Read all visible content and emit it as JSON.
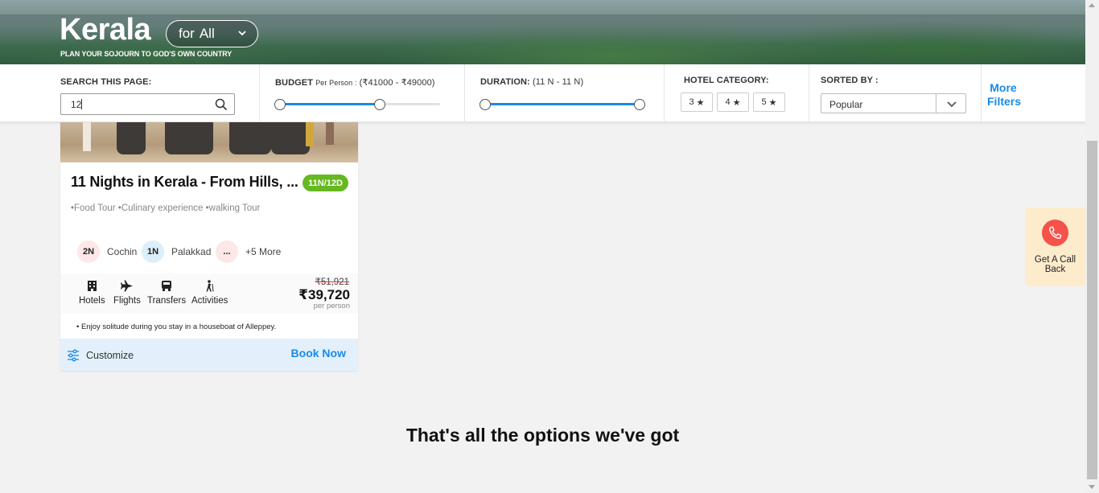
{
  "header": {
    "title": "Kerala",
    "subtitle": "PLAN YOUR SOJOURN TO GOD'S OWN COUNTRY",
    "for_prefix": "for",
    "for_value": "All"
  },
  "filters": {
    "search": {
      "label": "SEARCH THIS PAGE:",
      "value": "12"
    },
    "budget": {
      "label": "BUDGET",
      "sublabel": "Per Person :",
      "range": "(₹41000 - ₹49000)",
      "min_value": 41000,
      "max_value": 49000
    },
    "duration": {
      "label": "DURATION:",
      "range": "(11 N - 11 N)",
      "min_nights": 11,
      "max_nights": 11
    },
    "hotel_category": {
      "label": "HOTEL CATEGORY:",
      "options": [
        "3",
        "4",
        "5"
      ],
      "star_glyph": "★"
    },
    "sort": {
      "label": "SORTED BY :",
      "value": "Popular"
    },
    "more_filters": {
      "line1": "More",
      "line2": "Filters"
    }
  },
  "package": {
    "title": "11 Nights in Kerala - From Hills, ...",
    "duration_badge": "11N/12D",
    "highlights": "•Food Tour •Culinary experience •walking Tour",
    "cities": [
      {
        "nights": "2N",
        "name": "Cochin"
      },
      {
        "nights": "1N",
        "name": "Palakkad"
      },
      {
        "nights": "...",
        "name": "+5 More"
      }
    ],
    "inclusions": [
      {
        "icon": "hotel-icon",
        "label": "Hotels"
      },
      {
        "icon": "flight-icon",
        "label": "Flights"
      },
      {
        "icon": "transfer-icon",
        "label": "Transfers"
      },
      {
        "icon": "activity-icon",
        "label": "Activities"
      }
    ],
    "old_price": "₹51,921",
    "price": "₹39,720",
    "price_unit": "per person",
    "note": "• Enjoy solitude during you stay in a houseboat of Alleppey.",
    "customize_label": "Customize",
    "book_label": "Book Now"
  },
  "end_message": "That's all the options we've got",
  "callback": {
    "line1": "Get A Call",
    "line2": "Back"
  },
  "colors": {
    "accent": "#1a8ae6",
    "badge_green": "#66b821",
    "call_red": "#f4524a",
    "callback_bg": "#fdeccc"
  }
}
